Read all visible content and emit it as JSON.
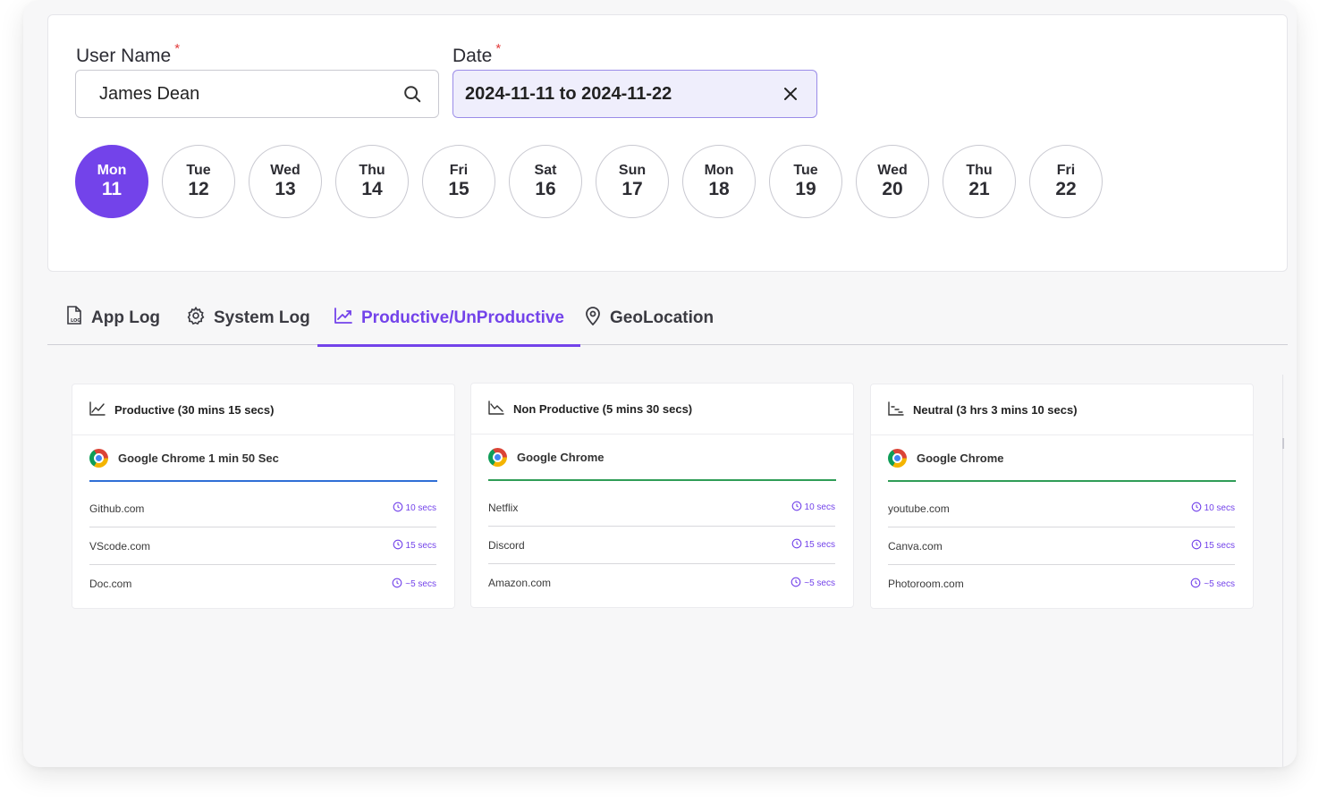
{
  "filters": {
    "user_label": "User Name",
    "user_required": "*",
    "user_value": "James Dean",
    "date_label": "Date",
    "date_required": "*",
    "date_value": "2024-11-11 to 2024-11-22"
  },
  "days": [
    {
      "name": "Mon",
      "date": "11",
      "active": true
    },
    {
      "name": "Tue",
      "date": "12"
    },
    {
      "name": "Wed",
      "date": "13"
    },
    {
      "name": "Thu",
      "date": "14"
    },
    {
      "name": "Fri",
      "date": "15"
    },
    {
      "name": "Sat",
      "date": "16"
    },
    {
      "name": "Sun",
      "date": "17"
    },
    {
      "name": "Mon",
      "date": "18"
    },
    {
      "name": "Tue",
      "date": "19"
    },
    {
      "name": "Wed",
      "date": "20"
    },
    {
      "name": "Thu",
      "date": "21"
    },
    {
      "name": "Fri",
      "date": "22"
    }
  ],
  "tabs": [
    {
      "label": "App Log",
      "icon": "log-file-icon"
    },
    {
      "label": "System Log",
      "icon": "gear-icon"
    },
    {
      "label": "Productive/UnProductive",
      "icon": "trend-chart-icon",
      "active": true
    },
    {
      "label": "GeoLocation",
      "icon": "location-pin-icon"
    }
  ],
  "panels": [
    {
      "title": "Productive (30 mins 15 secs)",
      "app": "Google Chrome 1 min 50 Sec",
      "sites": [
        {
          "name": "Github.com",
          "duration": "10 secs"
        },
        {
          "name": "VScode.com",
          "duration": "15 secs"
        },
        {
          "name": "Doc.com",
          "duration": "~5 secs"
        }
      ]
    },
    {
      "title": "Non Productive (5 mins 30 secs)",
      "app": "Google Chrome",
      "sites": [
        {
          "name": "Netflix",
          "duration": "10 secs"
        },
        {
          "name": "Discord",
          "duration": "15 secs"
        },
        {
          "name": "Amazon.com",
          "duration": "~5 secs"
        }
      ]
    },
    {
      "title": "Neutral (3 hrs 3 mins 10 secs)",
      "app": "Google Chrome",
      "sites": [
        {
          "name": "youtube.com",
          "duration": "10 secs"
        },
        {
          "name": "Canva.com",
          "duration": "15 secs"
        },
        {
          "name": "Photoroom.com",
          "duration": "~5 secs"
        }
      ]
    }
  ],
  "colors": {
    "accent": "#7343ea",
    "productive_line": "#2f6fd6",
    "other_line": "#2f9d57",
    "required": "#e23c3c"
  }
}
